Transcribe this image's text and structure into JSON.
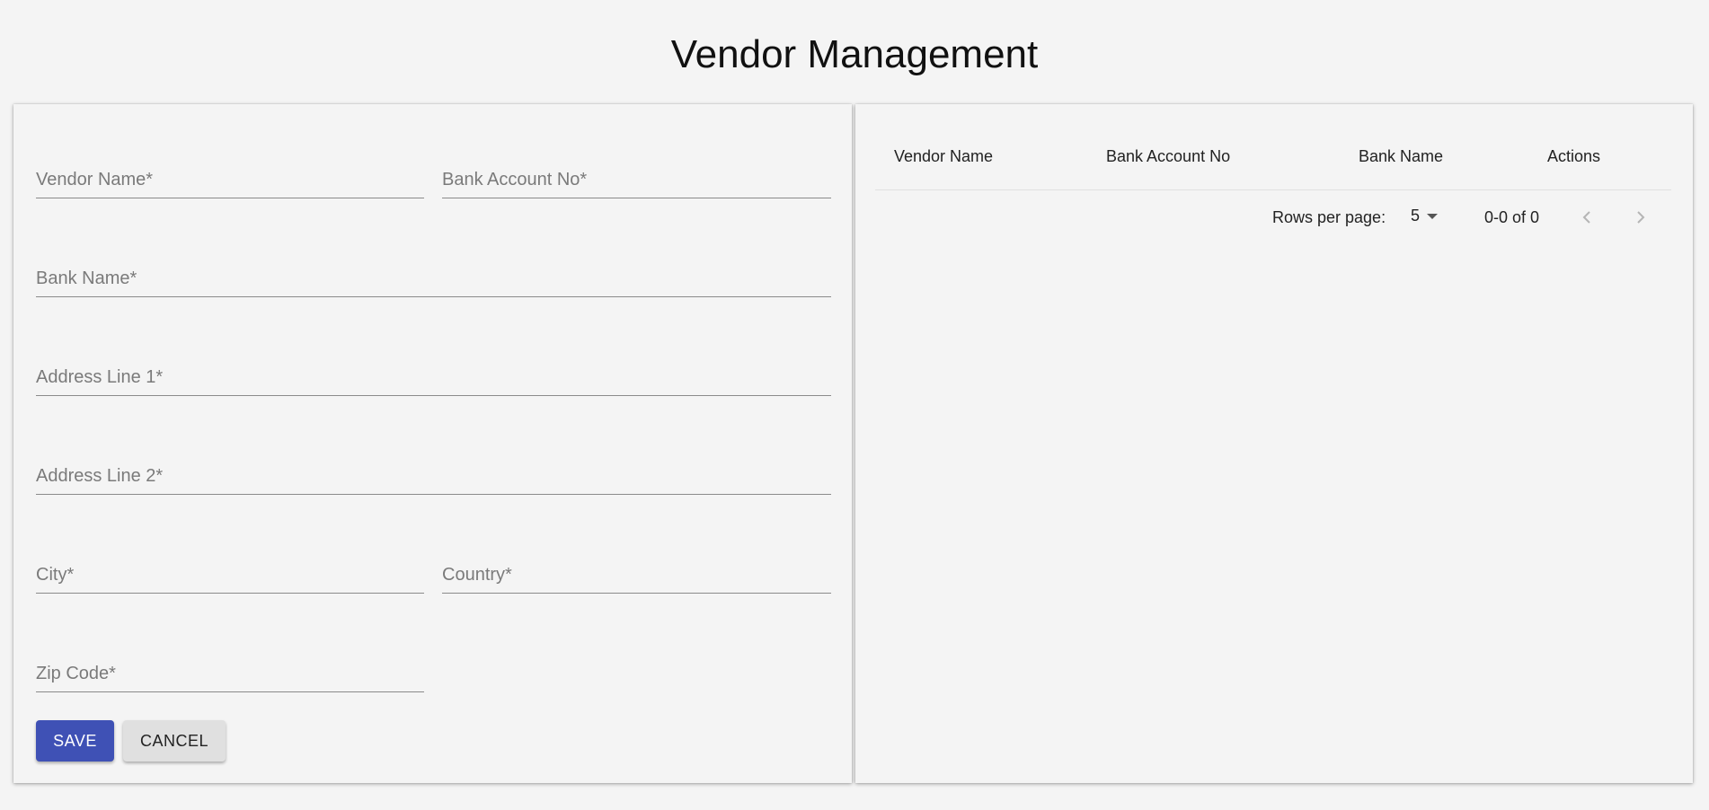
{
  "page": {
    "title": "Vendor Management"
  },
  "form": {
    "fields": {
      "vendor_name": {
        "placeholder": "Vendor Name*",
        "value": ""
      },
      "bank_account_no": {
        "placeholder": "Bank Account No*",
        "value": ""
      },
      "bank_name": {
        "placeholder": "Bank Name*",
        "value": ""
      },
      "address_line_1": {
        "placeholder": "Address Line 1*",
        "value": ""
      },
      "address_line_2": {
        "placeholder": "Address Line 2*",
        "value": ""
      },
      "city": {
        "placeholder": "City*",
        "value": ""
      },
      "country": {
        "placeholder": "Country*",
        "value": ""
      },
      "zip_code": {
        "placeholder": "Zip Code*",
        "value": ""
      }
    },
    "save_label": "SAVE",
    "cancel_label": "CANCEL"
  },
  "table": {
    "columns": [
      "Vendor Name",
      "Bank Account No",
      "Bank Name",
      "Actions"
    ],
    "rows": [],
    "pagination": {
      "rows_per_page_label": "Rows per page:",
      "rows_per_page_value": "5",
      "range_text": "0-0 of 0",
      "prev_icon": "chevron-left-icon",
      "next_icon": "chevron-right-icon"
    }
  },
  "colors": {
    "primary": "#3f51b5",
    "background": "#f4f4f4",
    "cancel_button": "#e0e0e0"
  }
}
